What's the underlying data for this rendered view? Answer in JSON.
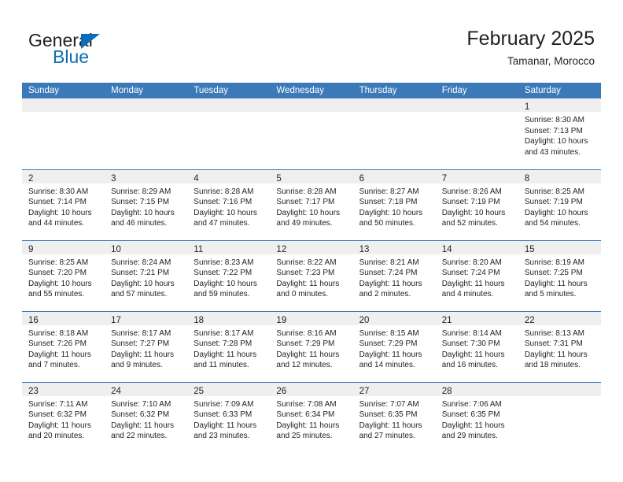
{
  "logo": {
    "word_one": "General",
    "word_two": "Blue",
    "triangle_icon": "triangle-icon",
    "brand_blue": "#0d6cb5"
  },
  "header": {
    "title": "February 2025",
    "subtitle": "Tamanar, Morocco",
    "accent_color": "#3b79b8",
    "band_color": "#efeff0"
  },
  "weekdays": [
    "Sunday",
    "Monday",
    "Tuesday",
    "Wednesday",
    "Thursday",
    "Friday",
    "Saturday"
  ],
  "weeks": [
    [
      {
        "day": "",
        "empty": true
      },
      {
        "day": "",
        "empty": true
      },
      {
        "day": "",
        "empty": true
      },
      {
        "day": "",
        "empty": true
      },
      {
        "day": "",
        "empty": true
      },
      {
        "day": "",
        "empty": true
      },
      {
        "day": "1",
        "sunrise": "Sunrise: 8:30 AM",
        "sunset": "Sunset: 7:13 PM",
        "daylight_1": "Daylight: 10 hours",
        "daylight_2": "and 43 minutes."
      }
    ],
    [
      {
        "day": "2",
        "sunrise": "Sunrise: 8:30 AM",
        "sunset": "Sunset: 7:14 PM",
        "daylight_1": "Daylight: 10 hours",
        "daylight_2": "and 44 minutes."
      },
      {
        "day": "3",
        "sunrise": "Sunrise: 8:29 AM",
        "sunset": "Sunset: 7:15 PM",
        "daylight_1": "Daylight: 10 hours",
        "daylight_2": "and 46 minutes."
      },
      {
        "day": "4",
        "sunrise": "Sunrise: 8:28 AM",
        "sunset": "Sunset: 7:16 PM",
        "daylight_1": "Daylight: 10 hours",
        "daylight_2": "and 47 minutes."
      },
      {
        "day": "5",
        "sunrise": "Sunrise: 8:28 AM",
        "sunset": "Sunset: 7:17 PM",
        "daylight_1": "Daylight: 10 hours",
        "daylight_2": "and 49 minutes."
      },
      {
        "day": "6",
        "sunrise": "Sunrise: 8:27 AM",
        "sunset": "Sunset: 7:18 PM",
        "daylight_1": "Daylight: 10 hours",
        "daylight_2": "and 50 minutes."
      },
      {
        "day": "7",
        "sunrise": "Sunrise: 8:26 AM",
        "sunset": "Sunset: 7:19 PM",
        "daylight_1": "Daylight: 10 hours",
        "daylight_2": "and 52 minutes."
      },
      {
        "day": "8",
        "sunrise": "Sunrise: 8:25 AM",
        "sunset": "Sunset: 7:19 PM",
        "daylight_1": "Daylight: 10 hours",
        "daylight_2": "and 54 minutes."
      }
    ],
    [
      {
        "day": "9",
        "sunrise": "Sunrise: 8:25 AM",
        "sunset": "Sunset: 7:20 PM",
        "daylight_1": "Daylight: 10 hours",
        "daylight_2": "and 55 minutes."
      },
      {
        "day": "10",
        "sunrise": "Sunrise: 8:24 AM",
        "sunset": "Sunset: 7:21 PM",
        "daylight_1": "Daylight: 10 hours",
        "daylight_2": "and 57 minutes."
      },
      {
        "day": "11",
        "sunrise": "Sunrise: 8:23 AM",
        "sunset": "Sunset: 7:22 PM",
        "daylight_1": "Daylight: 10 hours",
        "daylight_2": "and 59 minutes."
      },
      {
        "day": "12",
        "sunrise": "Sunrise: 8:22 AM",
        "sunset": "Sunset: 7:23 PM",
        "daylight_1": "Daylight: 11 hours",
        "daylight_2": "and 0 minutes."
      },
      {
        "day": "13",
        "sunrise": "Sunrise: 8:21 AM",
        "sunset": "Sunset: 7:24 PM",
        "daylight_1": "Daylight: 11 hours",
        "daylight_2": "and 2 minutes."
      },
      {
        "day": "14",
        "sunrise": "Sunrise: 8:20 AM",
        "sunset": "Sunset: 7:24 PM",
        "daylight_1": "Daylight: 11 hours",
        "daylight_2": "and 4 minutes."
      },
      {
        "day": "15",
        "sunrise": "Sunrise: 8:19 AM",
        "sunset": "Sunset: 7:25 PM",
        "daylight_1": "Daylight: 11 hours",
        "daylight_2": "and 5 minutes."
      }
    ],
    [
      {
        "day": "16",
        "sunrise": "Sunrise: 8:18 AM",
        "sunset": "Sunset: 7:26 PM",
        "daylight_1": "Daylight: 11 hours",
        "daylight_2": "and 7 minutes."
      },
      {
        "day": "17",
        "sunrise": "Sunrise: 8:17 AM",
        "sunset": "Sunset: 7:27 PM",
        "daylight_1": "Daylight: 11 hours",
        "daylight_2": "and 9 minutes."
      },
      {
        "day": "18",
        "sunrise": "Sunrise: 8:17 AM",
        "sunset": "Sunset: 7:28 PM",
        "daylight_1": "Daylight: 11 hours",
        "daylight_2": "and 11 minutes."
      },
      {
        "day": "19",
        "sunrise": "Sunrise: 8:16 AM",
        "sunset": "Sunset: 7:29 PM",
        "daylight_1": "Daylight: 11 hours",
        "daylight_2": "and 12 minutes."
      },
      {
        "day": "20",
        "sunrise": "Sunrise: 8:15 AM",
        "sunset": "Sunset: 7:29 PM",
        "daylight_1": "Daylight: 11 hours",
        "daylight_2": "and 14 minutes."
      },
      {
        "day": "21",
        "sunrise": "Sunrise: 8:14 AM",
        "sunset": "Sunset: 7:30 PM",
        "daylight_1": "Daylight: 11 hours",
        "daylight_2": "and 16 minutes."
      },
      {
        "day": "22",
        "sunrise": "Sunrise: 8:13 AM",
        "sunset": "Sunset: 7:31 PM",
        "daylight_1": "Daylight: 11 hours",
        "daylight_2": "and 18 minutes."
      }
    ],
    [
      {
        "day": "23",
        "sunrise": "Sunrise: 7:11 AM",
        "sunset": "Sunset: 6:32 PM",
        "daylight_1": "Daylight: 11 hours",
        "daylight_2": "and 20 minutes."
      },
      {
        "day": "24",
        "sunrise": "Sunrise: 7:10 AM",
        "sunset": "Sunset: 6:32 PM",
        "daylight_1": "Daylight: 11 hours",
        "daylight_2": "and 22 minutes."
      },
      {
        "day": "25",
        "sunrise": "Sunrise: 7:09 AM",
        "sunset": "Sunset: 6:33 PM",
        "daylight_1": "Daylight: 11 hours",
        "daylight_2": "and 23 minutes."
      },
      {
        "day": "26",
        "sunrise": "Sunrise: 7:08 AM",
        "sunset": "Sunset: 6:34 PM",
        "daylight_1": "Daylight: 11 hours",
        "daylight_2": "and 25 minutes."
      },
      {
        "day": "27",
        "sunrise": "Sunrise: 7:07 AM",
        "sunset": "Sunset: 6:35 PM",
        "daylight_1": "Daylight: 11 hours",
        "daylight_2": "and 27 minutes."
      },
      {
        "day": "28",
        "sunrise": "Sunrise: 7:06 AM",
        "sunset": "Sunset: 6:35 PM",
        "daylight_1": "Daylight: 11 hours",
        "daylight_2": "and 29 minutes."
      },
      {
        "day": "",
        "empty": true
      }
    ]
  ]
}
